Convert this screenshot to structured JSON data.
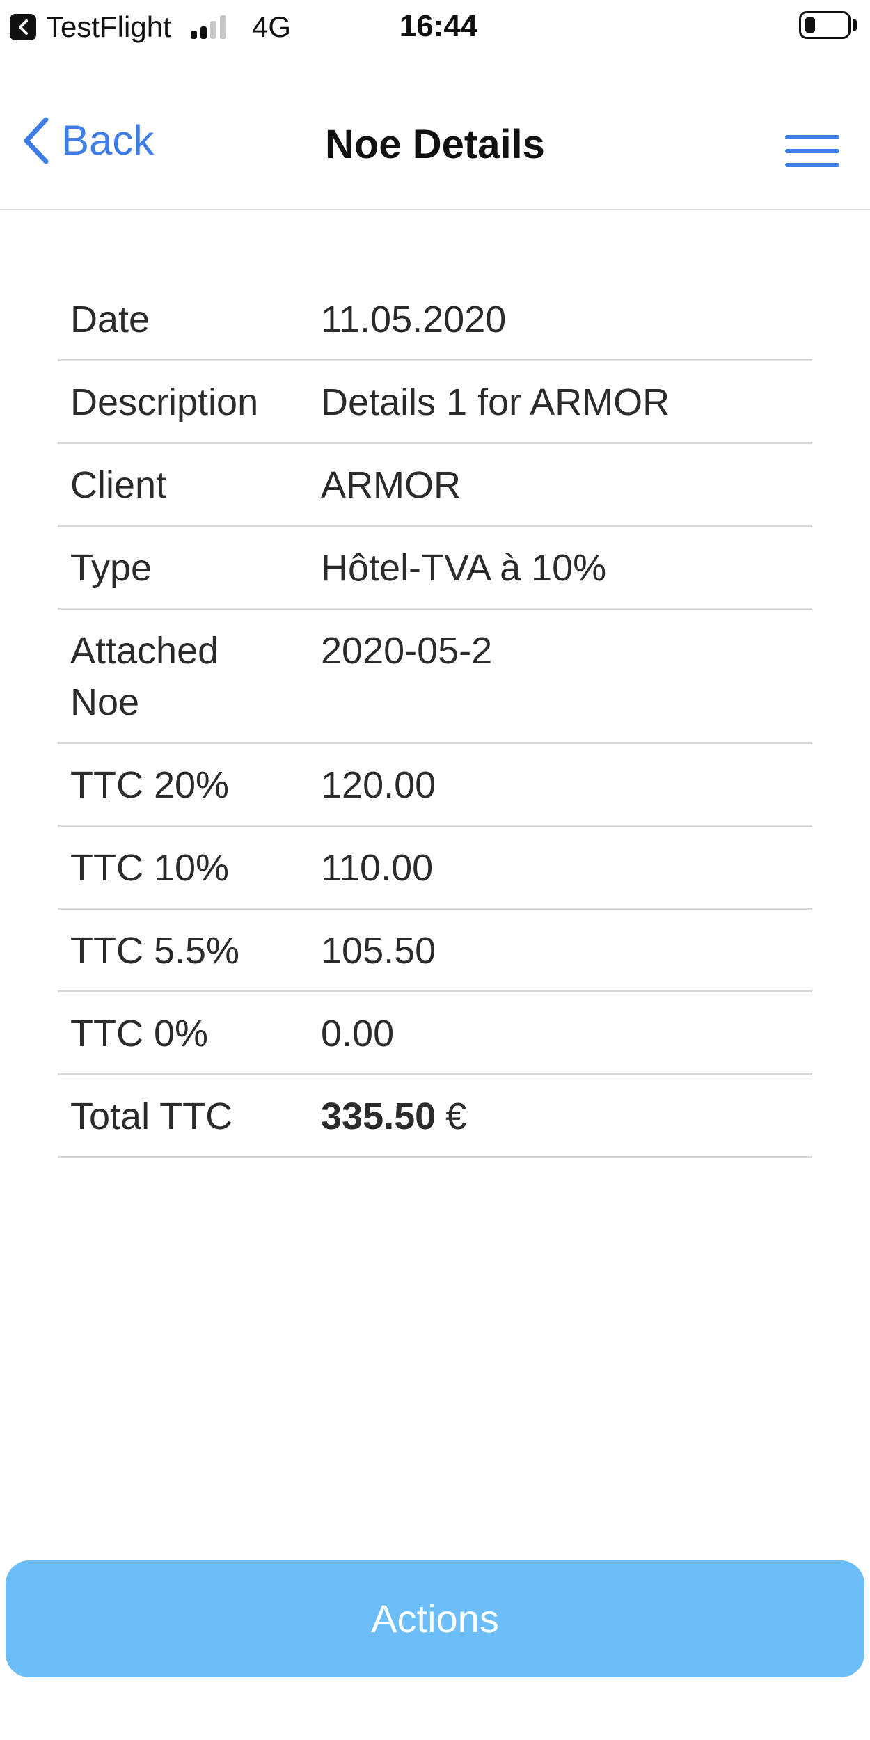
{
  "status_bar": {
    "back_app_icon": "chevron-left-icon",
    "app_name": "TestFlight",
    "signal_bars_active": 2,
    "signal_bars_total": 4,
    "network": "4G",
    "time": "16:44",
    "battery_level": 0.25
  },
  "nav": {
    "back_label": "Back",
    "back_icon": "chevron-left-icon",
    "title": "Noe Details",
    "menu_icon": "hamburger-menu-icon",
    "accent_color": "#3f7de6"
  },
  "details": {
    "rows": [
      {
        "label": "Date",
        "value": "11.05.2020"
      },
      {
        "label": "Description",
        "value": "Details 1 for ARMOR"
      },
      {
        "label": "Client",
        "value": "ARMOR"
      },
      {
        "label": "Type",
        "value": "Hôtel-TVA à 10%"
      },
      {
        "label": "Attached Noe",
        "value": "2020-05-2"
      },
      {
        "label": "TTC 20%",
        "value": "120.00"
      },
      {
        "label": "TTC 10%",
        "value": "110.00"
      },
      {
        "label": "TTC 5.5%",
        "value": "105.50"
      },
      {
        "label": "TTC 0%",
        "value": "0.00"
      }
    ],
    "total": {
      "label": "Total TTC",
      "amount": "335.50",
      "currency": "€"
    }
  },
  "actions": {
    "label": "Actions",
    "color": "#6bbef7"
  }
}
